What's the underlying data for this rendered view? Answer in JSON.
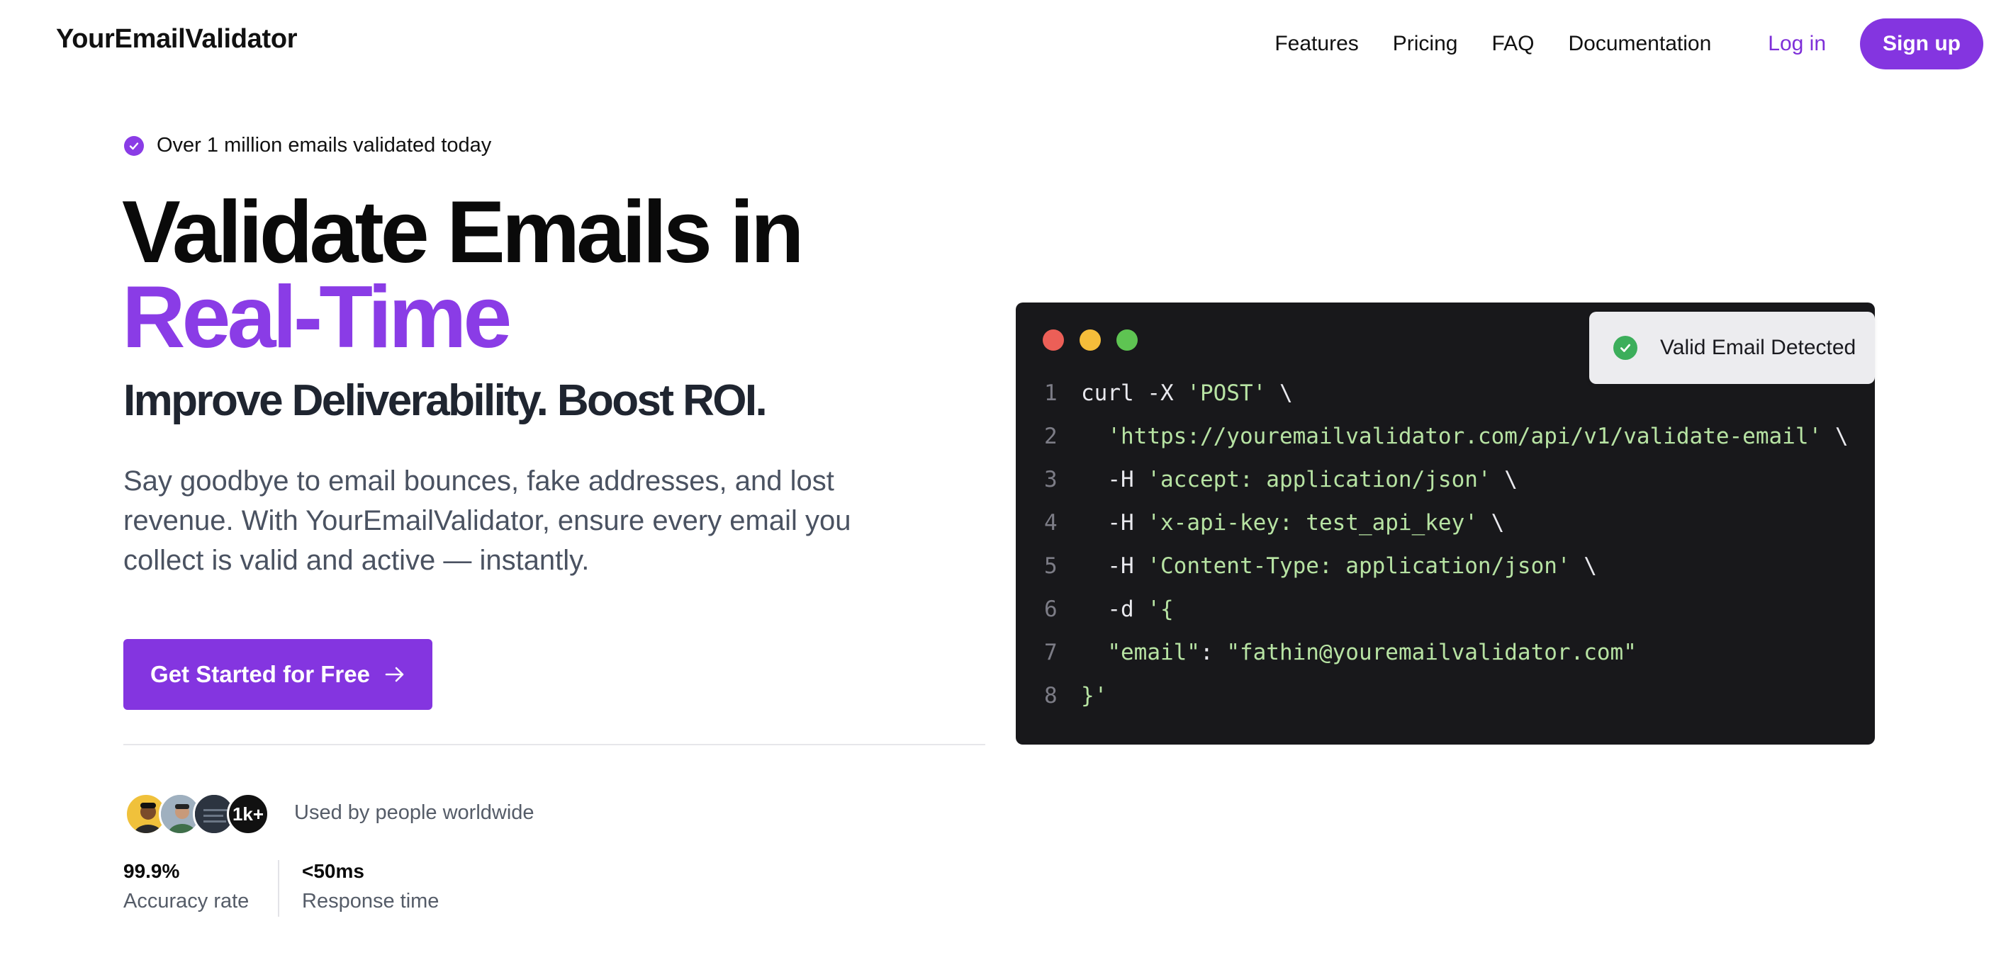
{
  "brand": {
    "name": "YourEmailValidator"
  },
  "nav": {
    "links": [
      "Features",
      "Pricing",
      "FAQ",
      "Documentation"
    ],
    "login": "Log in",
    "signup": "Sign up"
  },
  "hero": {
    "badge": "Over 1 million emails validated today",
    "title_line1": "Validate Emails in",
    "title_line2": "Real-Time",
    "subtitle": "Improve Deliverability. Boost ROI.",
    "description": "Say goodbye to email bounces, fake addresses, and lost revenue. With YourEmailValidator, ensure every email you collect is valid and active — instantly.",
    "cta": "Get Started for Free"
  },
  "social": {
    "avatar_more": "1k+",
    "users_text": "Used by people worldwide"
  },
  "stats": [
    {
      "value": "99.9%",
      "label": "Accuracy rate"
    },
    {
      "value": "<50ms",
      "label": "Response time"
    }
  ],
  "code": {
    "lines": [
      {
        "n": "1",
        "parts": [
          {
            "t": "curl -X ",
            "c": "p"
          },
          {
            "t": "'POST'",
            "c": "s"
          },
          {
            "t": " \\",
            "c": "p"
          }
        ]
      },
      {
        "n": "2",
        "parts": [
          {
            "t": "  'https://youremailvalidator.com/api/v1/validate-email'",
            "c": "s"
          },
          {
            "t": " \\",
            "c": "p"
          }
        ]
      },
      {
        "n": "3",
        "parts": [
          {
            "t": "  -H ",
            "c": "p"
          },
          {
            "t": "'accept: application/json'",
            "c": "s"
          },
          {
            "t": " \\",
            "c": "p"
          }
        ]
      },
      {
        "n": "4",
        "parts": [
          {
            "t": "  -H ",
            "c": "p"
          },
          {
            "t": "'x-api-key: test_api_key'",
            "c": "s"
          },
          {
            "t": " \\",
            "c": "p"
          }
        ]
      },
      {
        "n": "5",
        "parts": [
          {
            "t": "  -H ",
            "c": "p"
          },
          {
            "t": "'Content-Type: application/json'",
            "c": "s"
          },
          {
            "t": " \\",
            "c": "p"
          }
        ]
      },
      {
        "n": "6",
        "parts": [
          {
            "t": "  -d ",
            "c": "p"
          },
          {
            "t": "'{",
            "c": "s"
          }
        ]
      },
      {
        "n": "7",
        "parts": [
          {
            "t": "  \"email\"",
            "c": "s"
          },
          {
            "t": ": ",
            "c": "p"
          },
          {
            "t": "\"fathin@youremailvalidator.com\"",
            "c": "s"
          }
        ]
      },
      {
        "n": "8",
        "parts": [
          {
            "t": "}'",
            "c": "s"
          }
        ]
      }
    ],
    "window_dot_colors": [
      "#ec5f57",
      "#f5bd3a",
      "#5ec452"
    ]
  },
  "toast": {
    "text": "Valid Email Detected"
  },
  "colors": {
    "accent": "#8435e0",
    "success": "#3cae5b",
    "code_bg": "#18181b"
  }
}
